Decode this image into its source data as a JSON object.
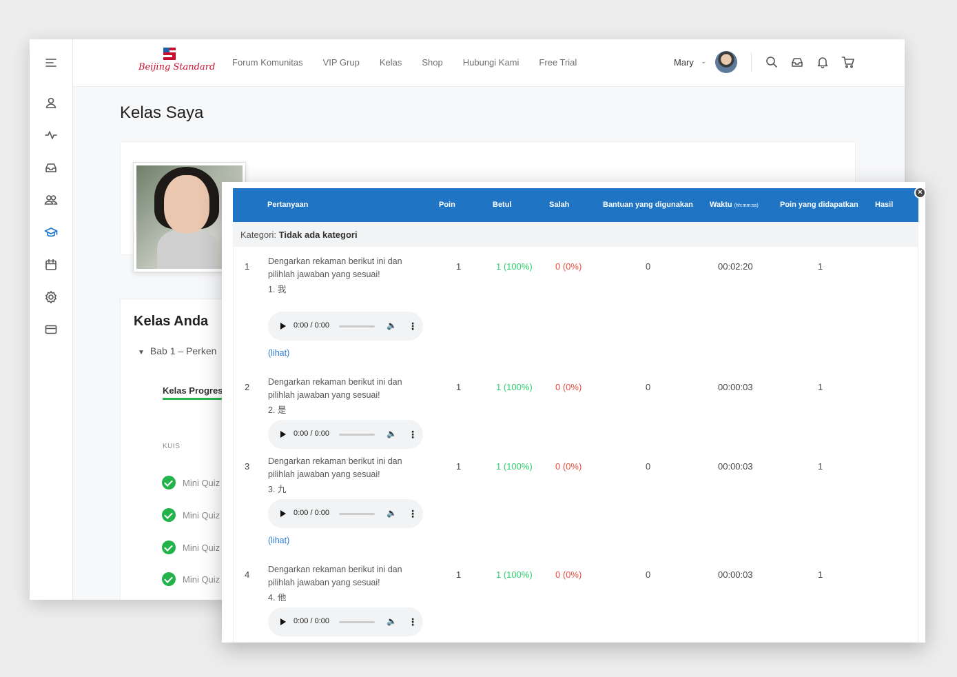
{
  "nav": {
    "logo_text": "Beijing Standard",
    "items": [
      "Forum Komunitas",
      "VIP Grup",
      "Kelas",
      "Shop",
      "Hubungi Kami",
      "Free Trial"
    ],
    "user_name": "Mary"
  },
  "page": {
    "title": "Kelas Saya",
    "kelas_anda": "Kelas Anda",
    "bab": "Bab 1 – Perken",
    "progress_tab": "Kelas Progress",
    "kuis_label": "KUIS",
    "quiz_items": [
      "Mini Quiz",
      "Mini Quiz",
      "Mini Quiz",
      "Mini Quiz"
    ]
  },
  "modal": {
    "close": "×",
    "headers": {
      "pertanyaan": "Pertanyaan",
      "poin": "Poin",
      "betul": "Betul",
      "salah": "Salah",
      "bantuan": "Bantuan yang digunakan",
      "waktu": "Waktu",
      "waktu_unit": "(hh:mm:ss)",
      "poin_didapat": "Poin yang didapatkan",
      "hasil": "Hasil"
    },
    "kategori_label": "Kategori:",
    "kategori_value": "Tidak ada kategori",
    "rows": [
      {
        "no": "1",
        "question": "Dengarkan rekaman berikut ini dan pilihlah jawaban yang sesuai!",
        "item": "1. 我",
        "poin": "1",
        "betul": "1 (100%)",
        "salah": "0 (0%)",
        "bantuan": "0",
        "waktu": "00:02:20",
        "didapat": "1",
        "audio_time": "0:00 / 0:00",
        "link": "(lihat)"
      },
      {
        "no": "2",
        "question": "Dengarkan rekaman berikut ini dan pilihlah jawaban yang sesuai!",
        "item": "2. 是",
        "poin": "1",
        "betul": "1 (100%)",
        "salah": "0 (0%)",
        "bantuan": "0",
        "waktu": "00:00:03",
        "didapat": "1",
        "audio_time": "0:00 / 0:00",
        "link": ""
      },
      {
        "no": "3",
        "question": "Dengarkan rekaman berikut ini dan pilihlah jawaban yang sesuai!",
        "item": "3. 九",
        "poin": "1",
        "betul": "1 (100%)",
        "salah": "0 (0%)",
        "bantuan": "0",
        "waktu": "00:00:03",
        "didapat": "1",
        "audio_time": "0:00 / 0:00",
        "link": "(lihat)"
      },
      {
        "no": "4",
        "question": "Dengarkan rekaman berikut ini dan pilihlah jawaban yang sesuai!",
        "item": "4. 他",
        "poin": "1",
        "betul": "1 (100%)",
        "salah": "0 (0%)",
        "bantuan": "0",
        "waktu": "00:00:03",
        "didapat": "1",
        "audio_time": "0:00 / 0:00",
        "link": ""
      }
    ]
  },
  "colors": {
    "header_blue": "#1f74c4",
    "success_green": "#2bd06a",
    "error_red": "#e74c3c",
    "link_blue": "#2b7bd3"
  }
}
